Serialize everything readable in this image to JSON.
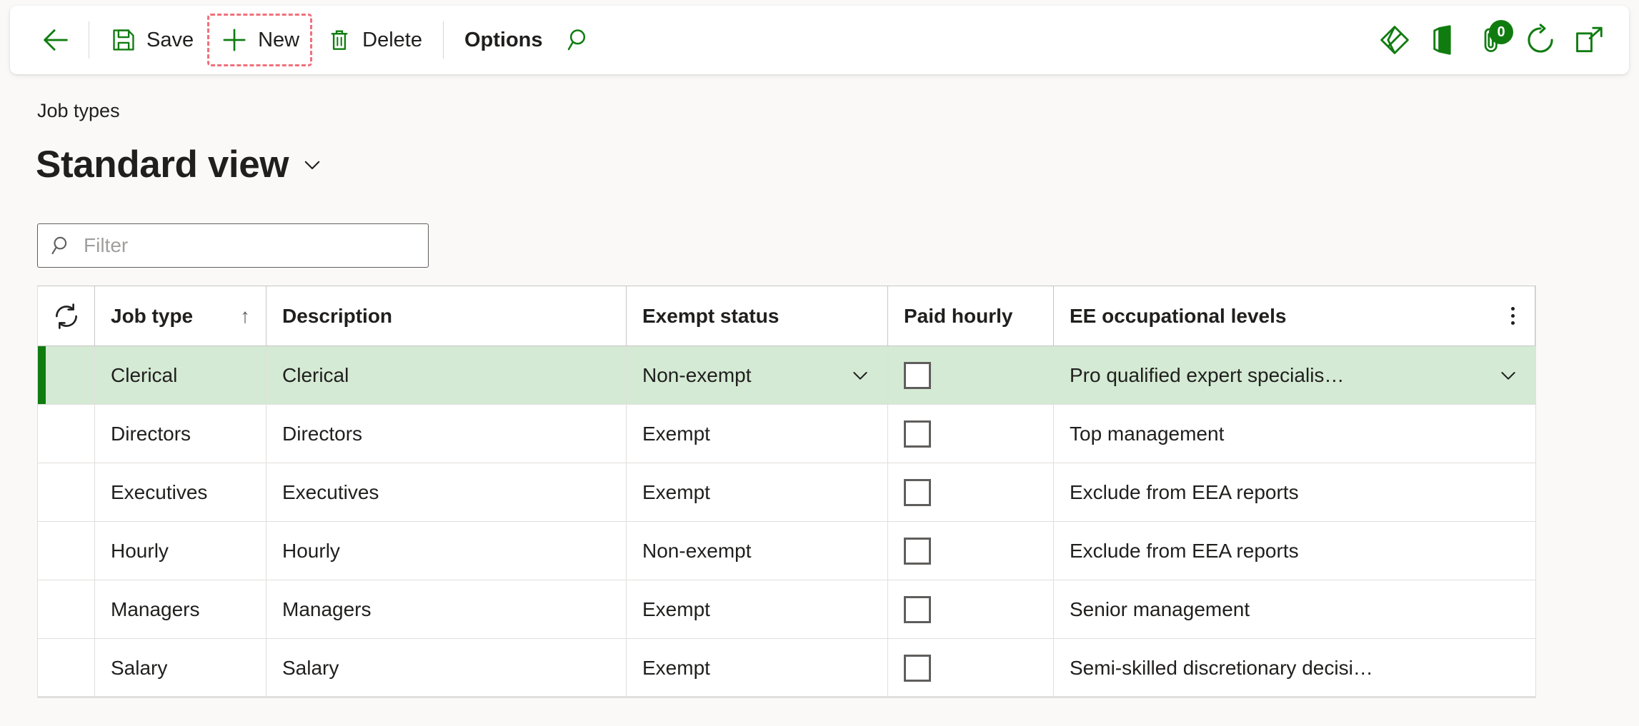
{
  "toolbar": {
    "back_label": "Back",
    "buttons": [
      {
        "id": "save",
        "label": "Save",
        "icon": "save-icon",
        "bold": false
      },
      {
        "id": "new",
        "label": "New",
        "icon": "plus-icon",
        "bold": false,
        "highlighted": true
      },
      {
        "id": "delete",
        "label": "Delete",
        "icon": "trash-icon",
        "bold": false
      },
      {
        "id": "options",
        "label": "Options",
        "icon": null,
        "bold": true
      }
    ],
    "search_icon": "search-icon",
    "right_icons": [
      {
        "id": "powerbi",
        "name": "power-apps-diamond-icon"
      },
      {
        "id": "office",
        "name": "office-icon"
      },
      {
        "id": "attach",
        "name": "attachment-icon",
        "badge": "0"
      },
      {
        "id": "refresh",
        "name": "refresh-icon"
      },
      {
        "id": "popout",
        "name": "open-in-new-window-icon"
      }
    ]
  },
  "page": {
    "breadcrumb": "Job types",
    "title": "Standard view"
  },
  "filter": {
    "placeholder": "Filter",
    "value": "",
    "icon": "search-icon"
  },
  "grid": {
    "refresh_icon": "refresh-grid-icon",
    "sort_indicator": "↑",
    "columns": [
      {
        "key": "job_type",
        "label": "Job type"
      },
      {
        "key": "description",
        "label": "Description"
      },
      {
        "key": "exempt_status",
        "label": "Exempt status"
      },
      {
        "key": "paid_hourly",
        "label": "Paid hourly"
      },
      {
        "key": "ee_levels",
        "label": "EE occupational levels"
      }
    ],
    "rows": [
      {
        "job_type": "Clerical",
        "description": "Clerical",
        "exempt_status": "Non-exempt",
        "paid_hourly": false,
        "ee_levels": "Pro qualified expert specialis…",
        "selected": true
      },
      {
        "job_type": "Directors",
        "description": "Directors",
        "exempt_status": "Exempt",
        "paid_hourly": false,
        "ee_levels": "Top management",
        "selected": false
      },
      {
        "job_type": "Executives",
        "description": "Executives",
        "exempt_status": "Exempt",
        "paid_hourly": false,
        "ee_levels": "Exclude from EEA reports",
        "selected": false
      },
      {
        "job_type": "Hourly",
        "description": "Hourly",
        "exempt_status": "Non-exempt",
        "paid_hourly": false,
        "ee_levels": "Exclude from EEA reports",
        "selected": false
      },
      {
        "job_type": "Managers",
        "description": "Managers",
        "exempt_status": "Exempt",
        "paid_hourly": false,
        "ee_levels": "Senior management",
        "selected": false
      },
      {
        "job_type": "Salary",
        "description": "Salary",
        "exempt_status": "Exempt",
        "paid_hourly": false,
        "ee_levels": "Semi-skilled discretionary decisi…",
        "selected": false
      }
    ]
  },
  "colors": {
    "accent_green": "#107c10",
    "selected_row_bg": "#d4ead4",
    "page_bg": "#faf9f8",
    "highlight_box": "#f1707a"
  }
}
